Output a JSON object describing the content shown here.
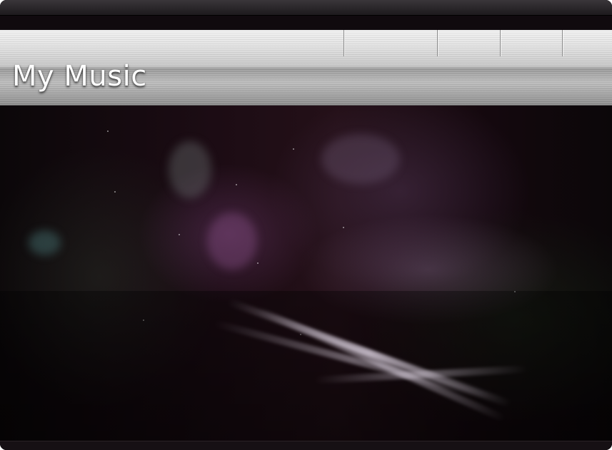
{
  "header": {
    "title": "My Music",
    "nav_tabs": [
      {
        "label": ""
      },
      {
        "label": ""
      },
      {
        "label": ""
      },
      {
        "label": ""
      }
    ]
  },
  "colors": {
    "header_silver": "#c9c9c9",
    "background_dark": "#060408",
    "title_text": "#ffffff"
  },
  "icons": {
    "background_art": "abstract-space-artwork"
  }
}
